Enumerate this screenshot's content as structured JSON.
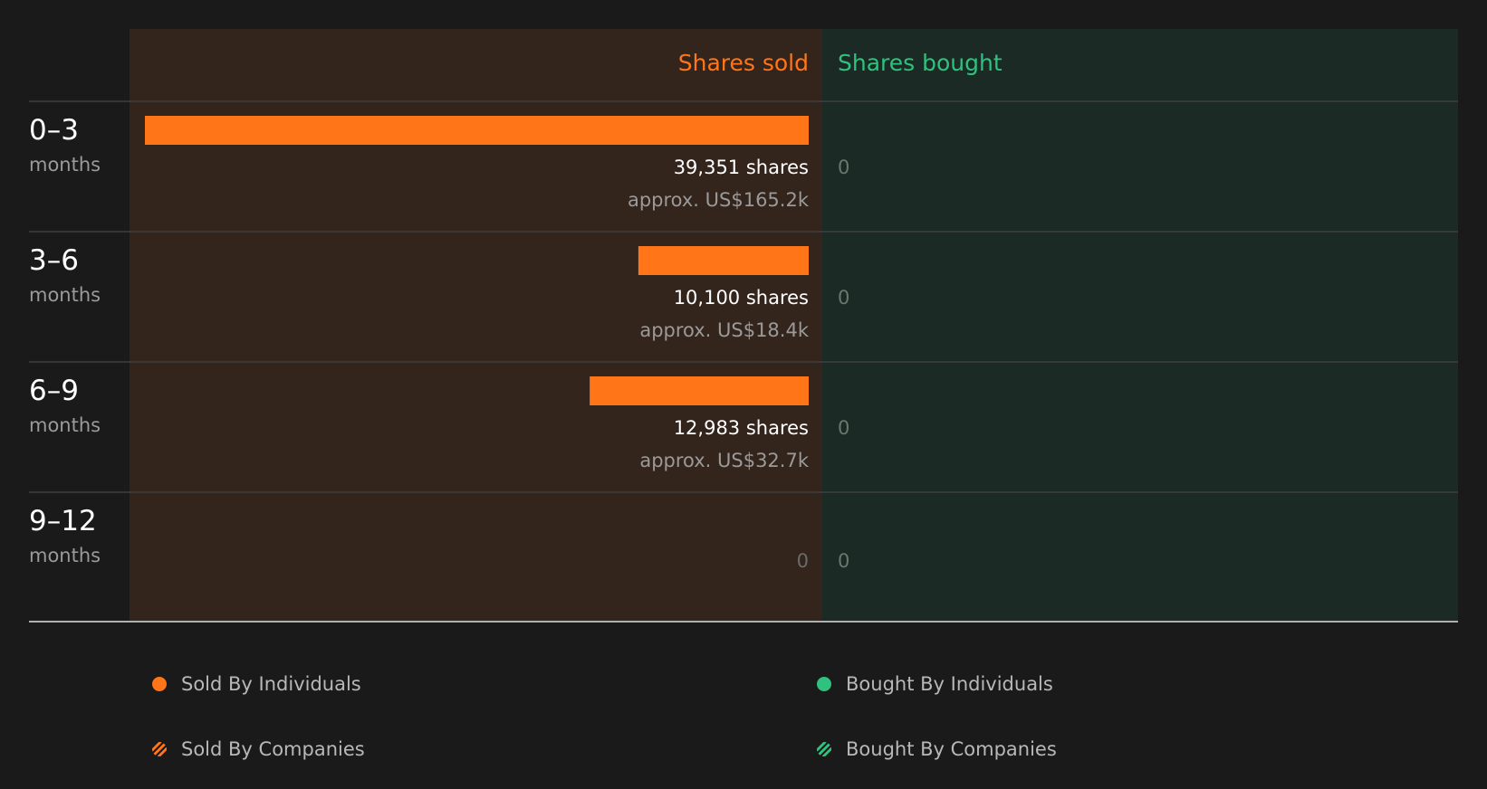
{
  "chart_data": {
    "type": "bar",
    "header": {
      "sold": "Shares sold",
      "bought": "Shares bought"
    },
    "categories": [
      {
        "range": "0–3",
        "unit": "months"
      },
      {
        "range": "3–6",
        "unit": "months"
      },
      {
        "range": "6–9",
        "unit": "months"
      },
      {
        "range": "9–12",
        "unit": "months"
      }
    ],
    "series": [
      {
        "name": "Shares sold",
        "values": [
          39351,
          10100,
          12983,
          0
        ]
      },
      {
        "name": "Shares bought",
        "values": [
          0,
          0,
          0,
          0
        ]
      }
    ],
    "sold_labels": [
      "39,351 shares",
      "10,100 shares",
      "12,983 shares",
      "0"
    ],
    "sold_value_labels": [
      "approx. US$165.2k",
      "approx. US$18.4k",
      "approx. US$32.7k",
      ""
    ],
    "bought_labels": [
      "0",
      "0",
      "0",
      "0"
    ],
    "xlim": [
      0,
      39351
    ],
    "legend": [
      {
        "label": "Sold By Individuals",
        "style": "solid",
        "color": "#ff7518"
      },
      {
        "label": "Bought By Individuals",
        "style": "solid",
        "color": "#2ec27e"
      },
      {
        "label": "Sold By Companies",
        "style": "hatched",
        "color": "#ff7518"
      },
      {
        "label": "Bought By Companies",
        "style": "hatched",
        "color": "#2ec27e"
      }
    ],
    "colors": {
      "sold": "#ff7518",
      "bought": "#2ec27e",
      "sold_panel": "#33241c",
      "bought_panel": "#1b2a24"
    }
  }
}
